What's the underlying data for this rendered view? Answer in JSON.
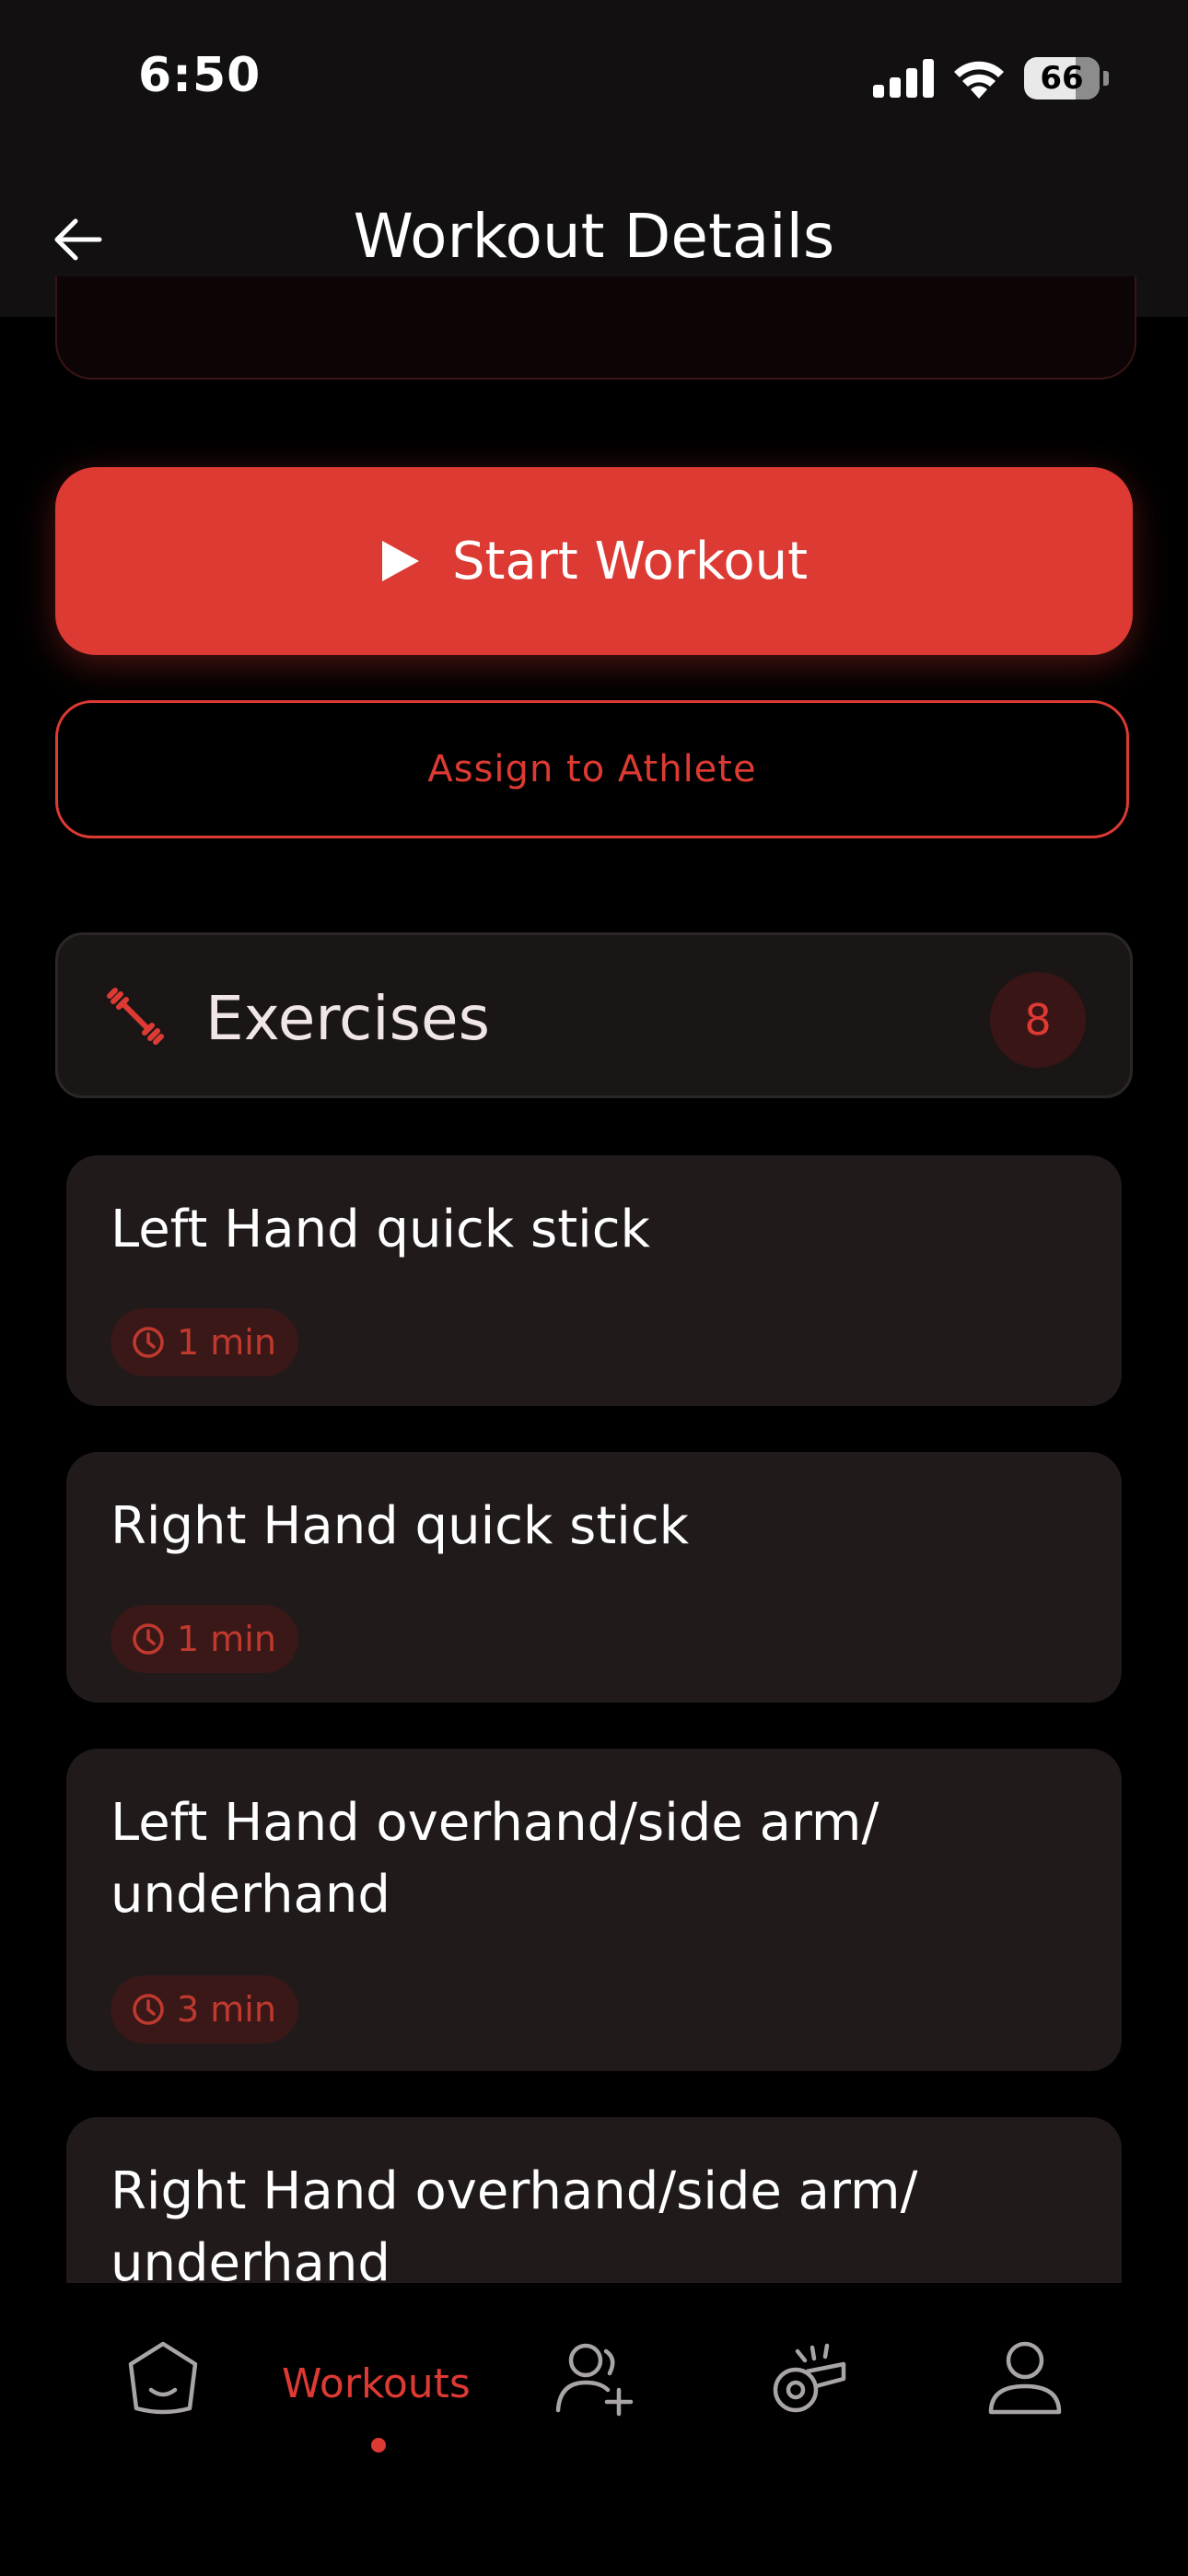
{
  "status": {
    "time": "6:50",
    "battery": "66"
  },
  "header": {
    "title": "Workout Details"
  },
  "actions": {
    "start_label": "Start Workout",
    "assign_label": "Assign to Athlete"
  },
  "exercises": {
    "title": "Exercises",
    "count": "8",
    "items": [
      {
        "name": "Left Hand quick stick",
        "duration": "1 min"
      },
      {
        "name": "Right Hand quick stick",
        "duration": "1 min"
      },
      {
        "name": "Left Hand overhand/side arm/",
        "name2": "underhand",
        "duration": "3 min"
      },
      {
        "name": "Right Hand overhand/side arm/",
        "name2": "underhand"
      }
    ]
  },
  "tabs": {
    "workouts_label": "Workouts"
  },
  "colors": {
    "accent": "#dc3a33",
    "card": "#201a1a",
    "background": "#000000"
  }
}
